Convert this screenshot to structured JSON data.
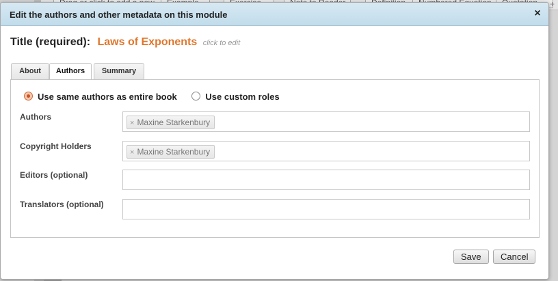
{
  "background_toolbar": {
    "buttons": [
      "Drag or click to add a new",
      "Example",
      "Exercise",
      "Note to Reader",
      "Definition",
      "Numbered Equation",
      "Quotation"
    ]
  },
  "dialog": {
    "title": "Edit the authors and other metadata on this module",
    "close_icon": "×",
    "title_label": "Title (required):",
    "title_value": "Laws of Exponents",
    "title_hint": "click to edit",
    "tabs": [
      {
        "label": "About",
        "active": false
      },
      {
        "label": "Authors",
        "active": true
      },
      {
        "label": "Summary",
        "active": false
      }
    ],
    "radio_options": [
      {
        "label": "Use same authors as entire book",
        "checked": true
      },
      {
        "label": "Use custom roles",
        "checked": false
      }
    ],
    "fields": [
      {
        "label": "Authors",
        "values": [
          "Maxine Starkenbury"
        ]
      },
      {
        "label": "Copyright Holders",
        "values": [
          "Maxine Starkenbury"
        ]
      },
      {
        "label": "Editors (optional)",
        "values": []
      },
      {
        "label": "Translators (optional)",
        "values": []
      }
    ],
    "chip_remove_icon": "×",
    "save_label": "Save",
    "cancel_label": "Cancel"
  },
  "colors": {
    "accent_title": "#e0762b",
    "titlebar": "#cbe2ee",
    "radio_checked": "#c9541f"
  }
}
